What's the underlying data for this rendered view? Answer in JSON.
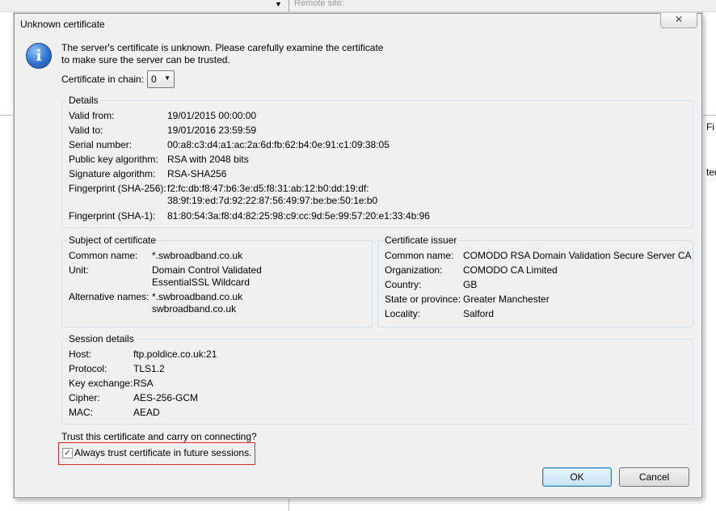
{
  "background": {
    "remote_site_label": "Remote site:",
    "right_edge_top": "Fi",
    "right_edge_mid": "ted"
  },
  "dialog": {
    "title": "Unknown certificate",
    "close_glyph": "✕",
    "message_line1": "The server's certificate is unknown. Please carefully examine the certificate",
    "message_line2": "to make sure the server can be trusted.",
    "chain_label": "Certificate in chain:",
    "chain_value": "0"
  },
  "details": {
    "legend": "Details",
    "rows": [
      {
        "label": "Valid from:",
        "value": "19/01/2015 00:00:00"
      },
      {
        "label": "Valid to:",
        "value": "19/01/2016 23:59:59"
      },
      {
        "label": "Serial number:",
        "value": "00:a8:c3:d4:a1:ac:2a:6d:fb:62:b4:0e:91:c1:09:38:05"
      },
      {
        "label": "Public key algorithm:",
        "value": "RSA with 2048 bits"
      },
      {
        "label": "Signature algorithm:",
        "value": "RSA-SHA256"
      },
      {
        "label": "Fingerprint (SHA-256):",
        "value": "f2:fc:db:f8:47:b6:3e:d5:f8:31:ab:12:b0:dd:19:df:",
        "value2": "38:9f:19:ed:7d:92:22:87:56:49:97:be:be:50:1e:b0"
      },
      {
        "label": "Fingerprint (SHA-1):",
        "value": "81:80:54:3a:f8:d4:82:25:98:c9:cc:9d:5e:99:57:20:e1:33:4b:96"
      }
    ]
  },
  "subject": {
    "legend": "Subject of certificate",
    "common_name_label": "Common name:",
    "common_name": "*.swbroadband.co.uk",
    "unit_label": "Unit:",
    "unit_1": "Domain Control Validated",
    "unit_2": "EssentialSSL Wildcard",
    "alt_label": "Alternative names:",
    "alt_1": "*.swbroadband.co.uk",
    "alt_2": "swbroadband.co.uk"
  },
  "issuer": {
    "legend": "Certificate issuer",
    "common_name_label": "Common name:",
    "common_name": "COMODO RSA Domain Validation Secure Server CA",
    "org_label": "Organization:",
    "org": "COMODO CA Limited",
    "country_label": "Country:",
    "country": "GB",
    "state_label": "State or province:",
    "state": "Greater Manchester",
    "locality_label": "Locality:",
    "locality": "Salford"
  },
  "session": {
    "legend": "Session details",
    "rows": [
      {
        "label": "Host:",
        "value": "ftp.poldice.co.uk:21"
      },
      {
        "label": "Protocol:",
        "value": "TLS1.2"
      },
      {
        "label": "Key exchange:",
        "value": "RSA"
      },
      {
        "label": "Cipher:",
        "value": "AES-256-GCM"
      },
      {
        "label": "MAC:",
        "value": "AEAD"
      }
    ]
  },
  "trust": {
    "question": "Trust this certificate and carry on connecting?",
    "always_trust_label": "Always trust certificate in future sessions.",
    "always_trust_checked": "✓"
  },
  "buttons": {
    "ok": "OK",
    "cancel": "Cancel"
  },
  "colors": {
    "highlight_border": "#d62a2a",
    "info_icon": "#2f74d0"
  }
}
